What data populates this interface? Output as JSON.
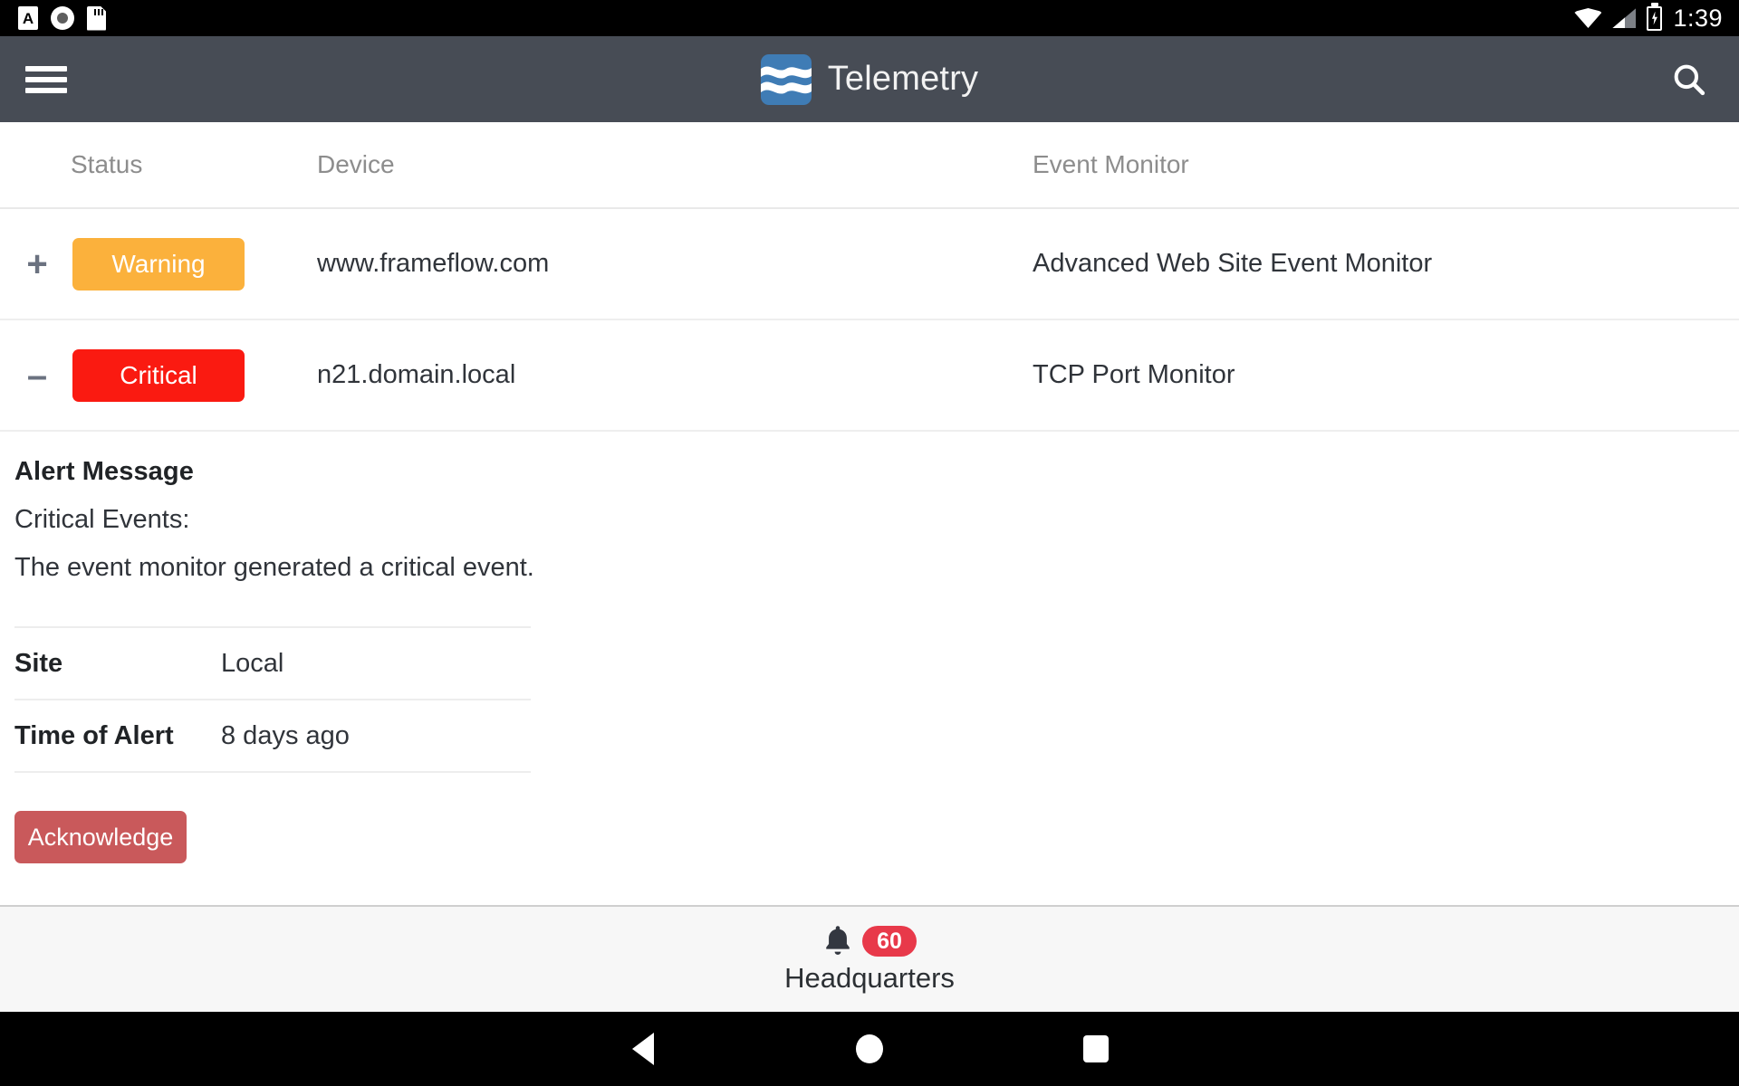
{
  "status_bar": {
    "time": "1:39",
    "left_icons": [
      {
        "name": "a-card-icon",
        "glyph": "A"
      },
      {
        "name": "record-circle-icon"
      },
      {
        "name": "sd-card-icon"
      }
    ],
    "right_icons": [
      {
        "name": "wifi-icon"
      },
      {
        "name": "cellular-signal-icon"
      },
      {
        "name": "battery-charging-icon"
      }
    ]
  },
  "app_bar": {
    "menu_icon": "hamburger-menu-icon",
    "logo_icon": "telemetry-waves-logo",
    "title": "Telemetry",
    "search_icon": "search-icon",
    "background_color": "#474c55",
    "logo_color": "#3f7cb5"
  },
  "table": {
    "headers": {
      "status": "Status",
      "device": "Device",
      "event_monitor": "Event Monitor"
    },
    "rows": [
      {
        "expander": "+",
        "expander_name": "expand-row-icon",
        "status": "Warning",
        "status_color": "#fbb13c",
        "device": "www.frameflow.com",
        "event_monitor": "Advanced Web Site Event Monitor",
        "expanded": false
      },
      {
        "expander": "–",
        "expander_name": "collapse-row-icon",
        "status": "Critical",
        "status_color": "#fa1a11",
        "device": "n21.domain.local",
        "event_monitor": "TCP Port Monitor",
        "expanded": true
      }
    ]
  },
  "detail_panel": {
    "alert_message_heading": "Alert Message",
    "alert_message_lines": [
      "Critical Events:",
      "The event monitor generated a critical event."
    ],
    "fields": [
      {
        "label": "Site",
        "value": "Local"
      },
      {
        "label": "Time of Alert",
        "value": "8 days ago"
      }
    ],
    "acknowledge_label": "Acknowledge",
    "acknowledge_color": "#c9595b"
  },
  "bottom_bar": {
    "bell_icon": "bell-icon",
    "alert_count": "60",
    "badge_color": "#e8394a",
    "label": "Headquarters"
  },
  "nav_bar": {
    "back": "back-triangle-icon",
    "home": "home-circle-icon",
    "recents": "recents-square-icon"
  }
}
